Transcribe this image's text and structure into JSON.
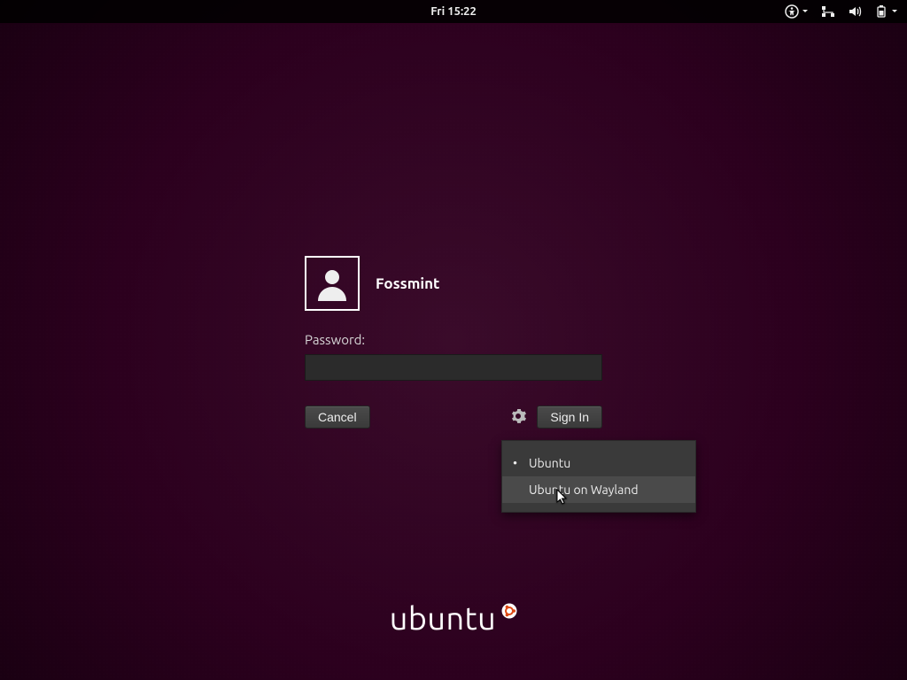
{
  "topbar": {
    "clock": "Fri 15:22"
  },
  "login": {
    "username": "Fossmint",
    "password_label": "Password:",
    "password_value": "",
    "cancel": "Cancel",
    "signin": "Sign In"
  },
  "session_menu": {
    "items": [
      {
        "label": "Ubuntu",
        "selected": true,
        "highlighted": false
      },
      {
        "label": "Ubuntu on Wayland",
        "selected": false,
        "highlighted": true
      }
    ]
  },
  "branding": {
    "name": "ubuntu"
  }
}
